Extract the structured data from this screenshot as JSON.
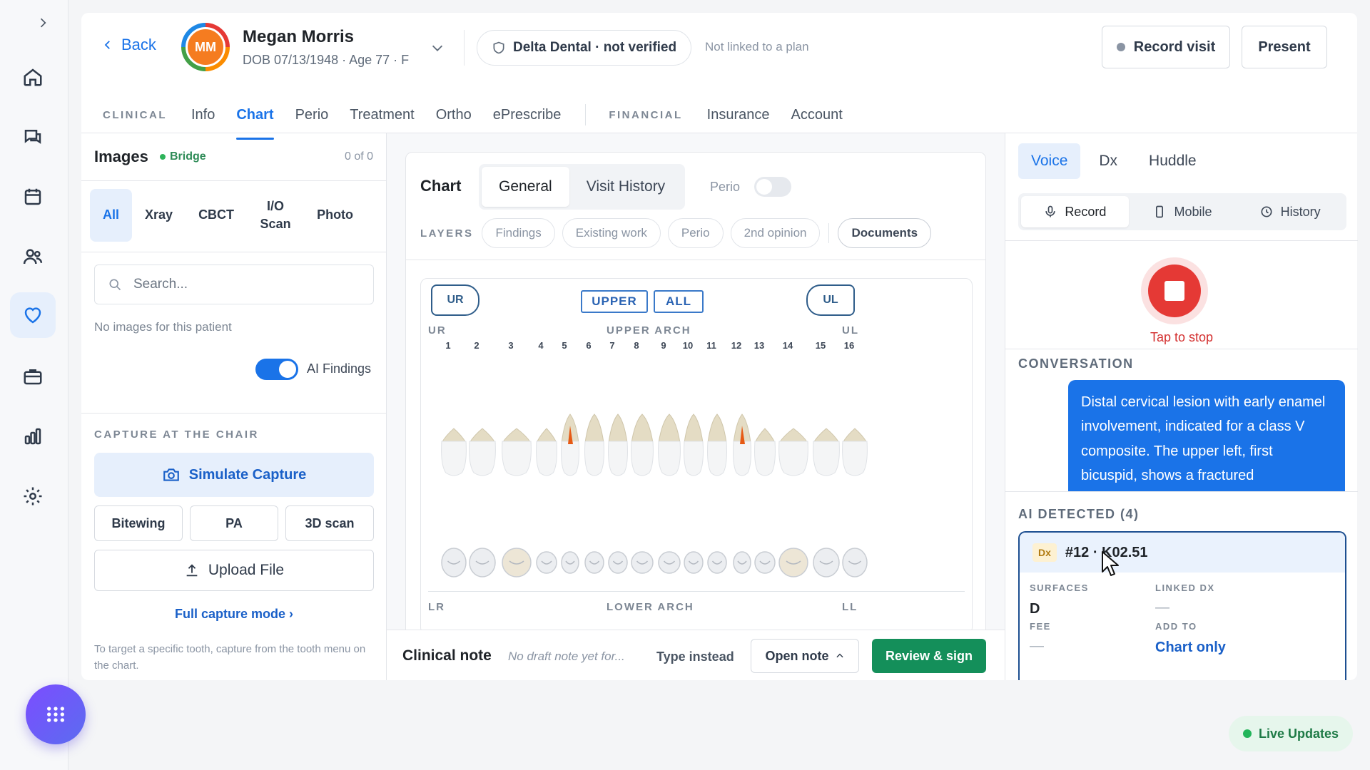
{
  "rail": {
    "items": [
      "home",
      "messages",
      "calendar",
      "patients",
      "health",
      "briefcase",
      "reports",
      "settings"
    ],
    "active": "health"
  },
  "header": {
    "back_label": "Back",
    "avatar_initials": "MM",
    "patient_name": "Megan Morris",
    "patient_meta": "DOB 07/13/1948 · Age 77 · F",
    "insurance_label": "Delta Dental · not verified",
    "plan_status": "Not linked to a plan",
    "record_visit_label": "Record visit",
    "present_label": "Present"
  },
  "nav": {
    "clinical_section": "CLINICAL",
    "clinical_tabs": [
      "Info",
      "Chart",
      "Perio",
      "Treatment",
      "Ortho",
      "ePrescribe"
    ],
    "active_tab": "Chart",
    "financial_section": "FINANCIAL",
    "financial_tabs": [
      "Insurance",
      "Account"
    ]
  },
  "images": {
    "title": "Images",
    "bridge_label": "Bridge",
    "count": "0 of 0",
    "filters": [
      "All",
      "Xray",
      "CBCT",
      "I/O Scan",
      "Photo"
    ],
    "active_filter": "All",
    "search_placeholder": "Search...",
    "empty_text": "No images for this patient",
    "ai_findings_label": "AI Findings",
    "ai_findings_on": true,
    "capture_title": "CAPTURE AT THE CHAIR",
    "simulate_label": "Simulate Capture",
    "capture_buttons": [
      "Bitewing",
      "PA",
      "3D scan"
    ],
    "upload_label": "Upload File",
    "full_capture_label": "Full capture mode ›",
    "hint": "To target a specific tooth, capture from the tooth menu on the chart."
  },
  "chart": {
    "title": "Chart",
    "views": [
      "General",
      "Visit History"
    ],
    "active_view": "General",
    "perio_label": "Perio",
    "perio_on": false,
    "layers_label": "LAYERS",
    "layers": [
      "Findings",
      "Existing work",
      "Perio",
      "2nd opinion"
    ],
    "documents_label": "Documents",
    "quadrant_ur": "UR",
    "quadrant_ul": "UL",
    "upper_btn": "UPPER",
    "all_btn": "ALL",
    "upper_arch_label": "UPPER ARCH",
    "lower_arch_label": "LOWER ARCH",
    "corner_ur": "UR",
    "corner_ul": "UL",
    "corner_lr": "LR",
    "corner_ll": "LL",
    "tooth_numbers": [
      "1",
      "2",
      "3",
      "4",
      "5",
      "6",
      "7",
      "8",
      "9",
      "10",
      "11",
      "12",
      "13",
      "14",
      "15",
      "16"
    ],
    "highlighted_teeth": [
      "5",
      "12"
    ],
    "highlight_color": "#e65a14"
  },
  "note": {
    "title": "Clinical note",
    "draft": "No draft note yet for...",
    "type_instead": "Type instead",
    "open_note": "Open note",
    "review_sign": "Review & sign"
  },
  "assistant": {
    "tabs": [
      "Voice",
      "Dx",
      "Huddle"
    ],
    "active_tab": "Voice",
    "modes": [
      "Record",
      "Mobile",
      "History"
    ],
    "active_mode": "Record",
    "tap_to_stop": "Tap to stop",
    "conversation_label": "CONVERSATION",
    "transcript": "Distal cervical lesion with early enamel involvement, indicated for a class V composite. The upper left, first bicuspid, shows a fractured",
    "ai_detected_label": "AI DETECTED (4)",
    "detection": {
      "badge": "Dx",
      "code": "#12 · K02.51",
      "surfaces_label": "SURFACES",
      "surfaces_value": "D",
      "linked_dx_label": "LINKED DX",
      "linked_dx_value": "—",
      "fee_label": "FEE",
      "fee_value": "—",
      "add_to_label": "ADD TO",
      "add_to_value": "Chart only"
    }
  },
  "status": {
    "live_updates": "Live Updates"
  },
  "colors": {
    "accent": "#1a73e8",
    "record": "#e53935",
    "success": "#148f5a"
  }
}
